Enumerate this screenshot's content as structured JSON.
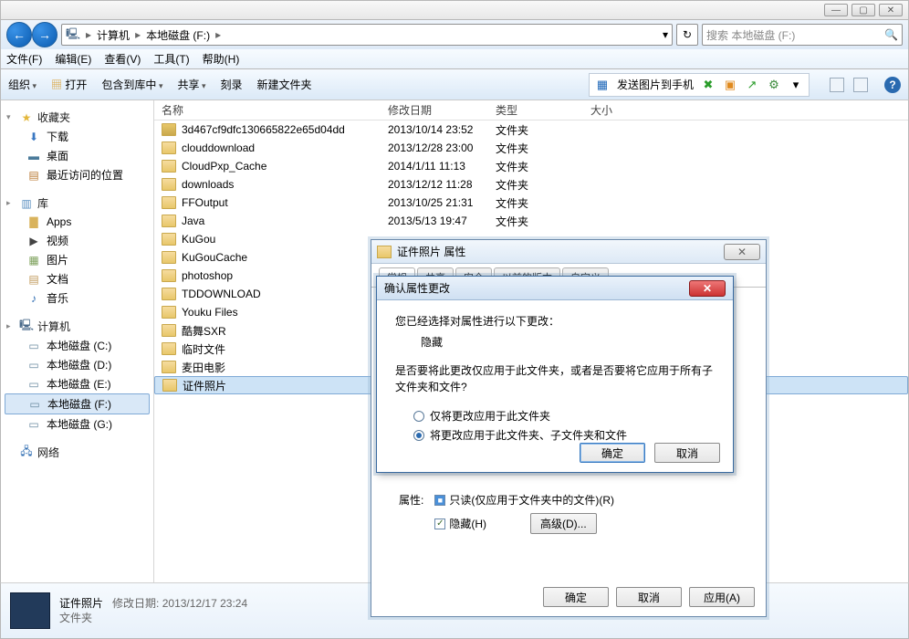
{
  "window": {
    "min": "—",
    "max": "▢",
    "close": "✕"
  },
  "nav": {
    "back": "←",
    "fwd": "→",
    "crumbs": [
      "计算机",
      "本地磁盘 (F:)"
    ],
    "dropdown": "▾",
    "refresh": "↻"
  },
  "search": {
    "placeholder": "搜索 本地磁盘 (F:)",
    "icon": "🔍"
  },
  "menus": [
    "文件(F)",
    "编辑(E)",
    "查看(V)",
    "工具(T)",
    "帮助(H)"
  ],
  "toolbar": {
    "organize": "组织",
    "open": "打开",
    "include": "包含到库中",
    "share": "共享",
    "burn": "刻录",
    "newfolder": "新建文件夹",
    "sendphone": "发送图片到手机"
  },
  "columns": {
    "name": "名称",
    "date": "修改日期",
    "type": "类型",
    "size": "大小"
  },
  "sidebar": {
    "fav": "收藏夹",
    "fav_items": [
      "下载",
      "桌面",
      "最近访问的位置"
    ],
    "lib": "库",
    "lib_items": [
      "Apps",
      "视频",
      "图片",
      "文档",
      "音乐"
    ],
    "comp": "计算机",
    "drives": [
      "本地磁盘 (C:)",
      "本地磁盘 (D:)",
      "本地磁盘 (E:)",
      "本地磁盘 (F:)",
      "本地磁盘 (G:)"
    ],
    "net": "网络"
  },
  "files": [
    {
      "n": "3d467cf9dfc130665822e65d04dd",
      "d": "2013/10/14 23:52",
      "t": "文件夹",
      "lock": true
    },
    {
      "n": "clouddownload",
      "d": "2013/12/28 23:00",
      "t": "文件夹"
    },
    {
      "n": "CloudPxp_Cache",
      "d": "2014/1/11 11:13",
      "t": "文件夹"
    },
    {
      "n": "downloads",
      "d": "2013/12/12 11:28",
      "t": "文件夹"
    },
    {
      "n": "FFOutput",
      "d": "2013/10/25 21:31",
      "t": "文件夹"
    },
    {
      "n": "Java",
      "d": "2013/5/13 19:47",
      "t": "文件夹"
    },
    {
      "n": "KuGou",
      "d": "",
      "t": ""
    },
    {
      "n": "KuGouCache",
      "d": "",
      "t": ""
    },
    {
      "n": "photoshop",
      "d": "",
      "t": ""
    },
    {
      "n": "TDDOWNLOAD",
      "d": "",
      "t": ""
    },
    {
      "n": "Youku Files",
      "d": "",
      "t": ""
    },
    {
      "n": "酷舞SXR",
      "d": "",
      "t": ""
    },
    {
      "n": "临时文件",
      "d": "",
      "t": ""
    },
    {
      "n": "麦田电影",
      "d": "",
      "t": ""
    },
    {
      "n": "证件照片",
      "d": "",
      "t": "",
      "sel": true
    }
  ],
  "details": {
    "name": "证件照片",
    "meta_label": "修改日期:",
    "meta_value": "2013/12/17 23:24",
    "type": "文件夹"
  },
  "prop": {
    "title": "证件照片 属性",
    "tabs": [
      "常规",
      "共享",
      "安全",
      "以前的版本",
      "自定义"
    ],
    "attr_label": "属性:",
    "readonly": "只读(仅应用于文件夹中的文件)(R)",
    "hidden": "隐藏(H)",
    "advanced": "高级(D)...",
    "ok": "确定",
    "cancel": "取消",
    "apply": "应用(A)"
  },
  "confirm": {
    "title": "确认属性更改",
    "line1": "您已经选择对属性进行以下更改：",
    "changed": "隐藏",
    "line2": "是否要将此更改仅应用于此文件夹，或者是否要将它应用于所有子文件夹和文件?",
    "opt1": "仅将更改应用于此文件夹",
    "opt2": "将更改应用于此文件夹、子文件夹和文件",
    "ok": "确定",
    "cancel": "取消"
  }
}
